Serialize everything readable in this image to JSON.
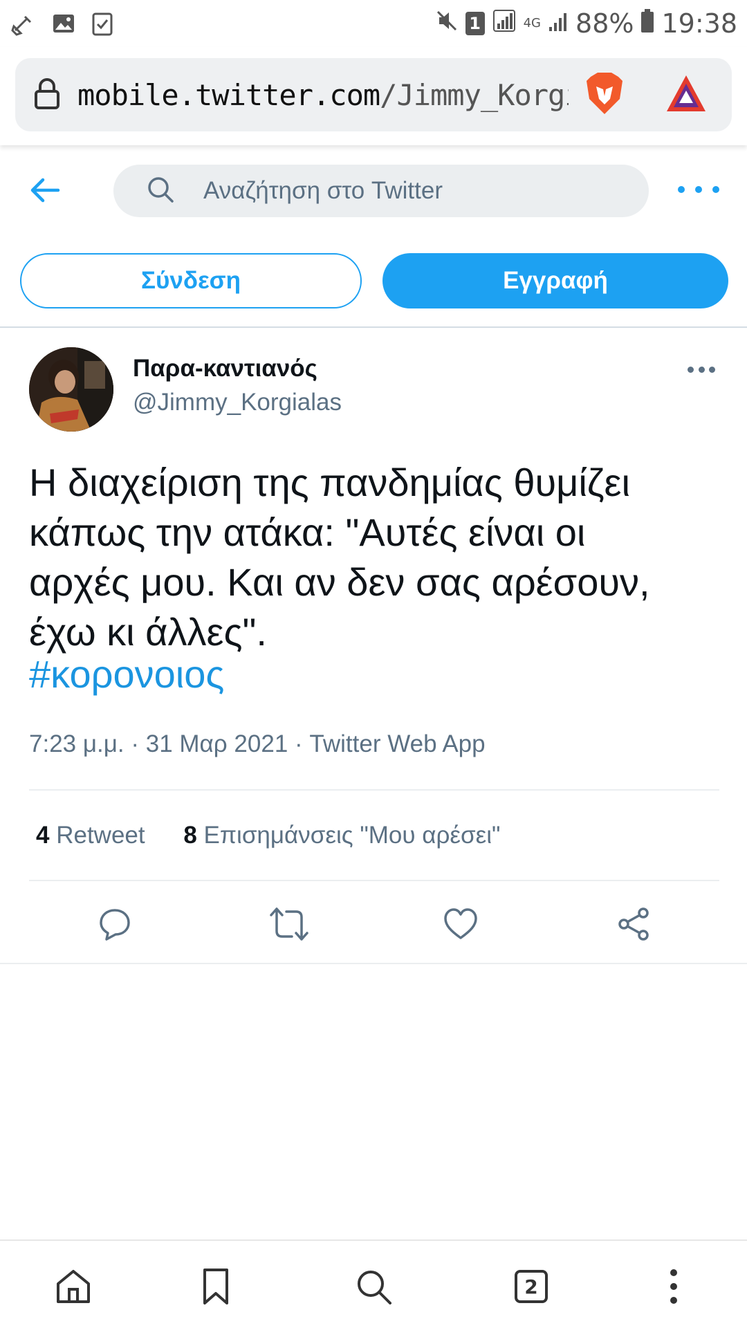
{
  "status_bar": {
    "battery": "88%",
    "time": "19:38",
    "network": "4G",
    "sim_badge": "1"
  },
  "browser": {
    "url_host": "mobile.twitter.com",
    "url_path": "/Jimmy_Korgiala",
    "open_tabs": "2"
  },
  "twitter_header": {
    "search_placeholder": "Αναζήτηση στο Twitter"
  },
  "auth": {
    "login_label": "Σύνδεση",
    "signup_label": "Εγγραφή"
  },
  "tweet": {
    "display_name": "Παρα-καντιανός",
    "handle": "@Jimmy_Korgialas",
    "text_lines": [
      "Η διαχείριση της πανδημίας θυμίζει",
      "κάπως την ατάκα: \"Αυτές είναι οι",
      "αρχές μου. Και αν δεν σας αρέσουν,",
      "έχω κι άλλες\"."
    ],
    "hashtag": "#κορονοιος",
    "time": "7:23 μ.μ.",
    "date": "31 Μαρ 2021",
    "source": "Twitter Web App",
    "retweet_count": "4",
    "retweet_label": "Retweet",
    "likes_count": "8",
    "likes_label": "Επισημάνσεις \"Μου αρέσει\""
  },
  "colors": {
    "accent": "#1da1f2",
    "secondary_text": "#5b7083",
    "hashtag": "#1b95e0"
  }
}
